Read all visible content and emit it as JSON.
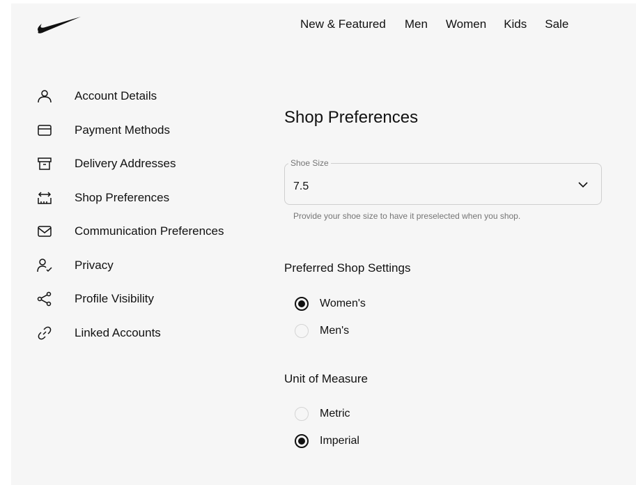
{
  "header": {
    "logo_icon": "nike-swoosh-icon",
    "nav": [
      "New & Featured",
      "Men",
      "Women",
      "Kids",
      "Sale"
    ]
  },
  "sidebar": {
    "items": [
      {
        "label": "Account Details",
        "icon": "user-icon"
      },
      {
        "label": "Payment Methods",
        "icon": "credit-card-icon"
      },
      {
        "label": "Delivery Addresses",
        "icon": "box-icon"
      },
      {
        "label": "Shop Preferences",
        "icon": "ruler-icon"
      },
      {
        "label": "Communication Preferences",
        "icon": "mail-icon"
      },
      {
        "label": "Privacy",
        "icon": "user-check-icon"
      },
      {
        "label": "Profile Visibility",
        "icon": "share-icon"
      },
      {
        "label": "Linked Accounts",
        "icon": "link-icon"
      }
    ]
  },
  "main": {
    "title": "Shop Preferences",
    "shoe_size": {
      "label": "Shoe Size",
      "value": "7.5",
      "helper": "Provide your shoe size to have it preselected when you shop."
    },
    "preferred_shop": {
      "heading": "Preferred Shop Settings",
      "options": [
        {
          "label": "Women's",
          "checked": true
        },
        {
          "label": "Men's",
          "checked": false
        }
      ]
    },
    "unit_of_measure": {
      "heading": "Unit of Measure",
      "options": [
        {
          "label": "Metric",
          "checked": false
        },
        {
          "label": "Imperial",
          "checked": true
        }
      ]
    }
  },
  "colors": {
    "text": "#111111",
    "muted": "#757575",
    "panel": "#f6f6f6",
    "border": "#cfcfcf"
  }
}
